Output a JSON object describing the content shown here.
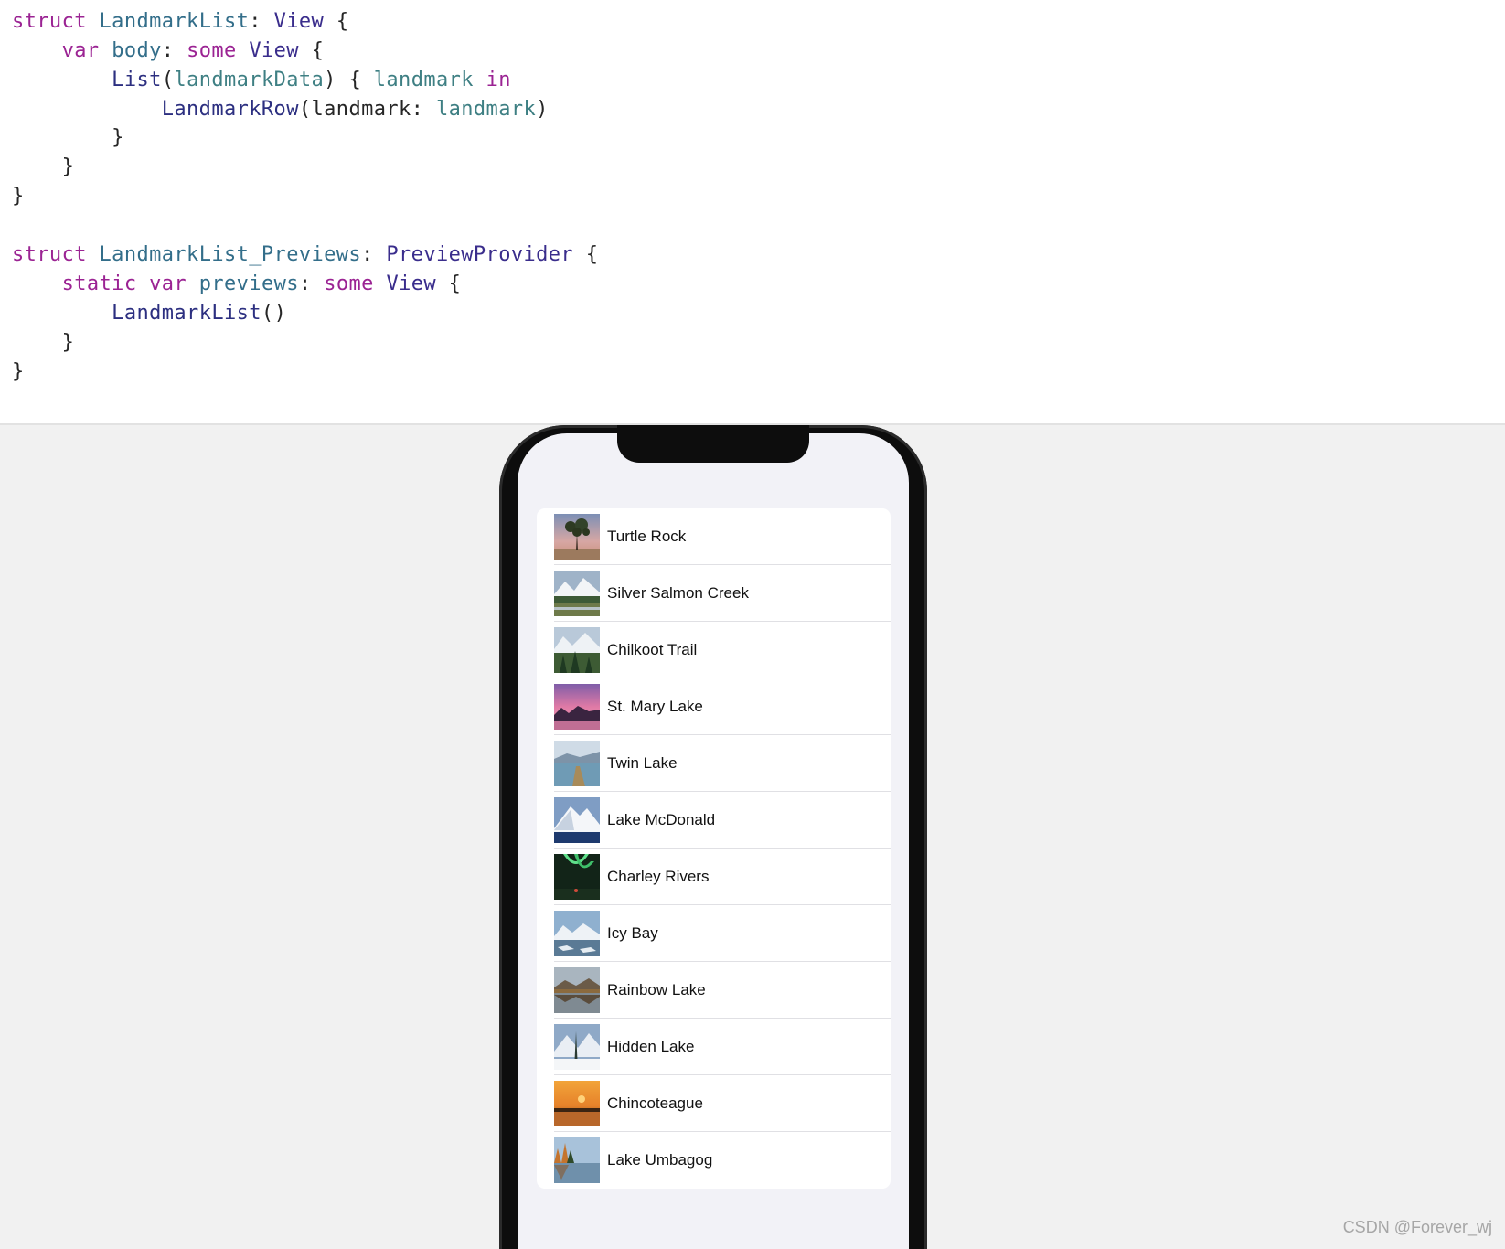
{
  "editor": {
    "lines": [
      [
        {
          "t": "struct",
          "c": "kw"
        },
        {
          "t": " ",
          "c": "pl"
        },
        {
          "t": "LandmarkList",
          "c": "dc"
        },
        {
          "t": ": ",
          "c": "pl"
        },
        {
          "t": "View",
          "c": "ty"
        },
        {
          "t": " {",
          "c": "pl"
        }
      ],
      [
        {
          "t": "    ",
          "c": "pl"
        },
        {
          "t": "var",
          "c": "kw"
        },
        {
          "t": " ",
          "c": "pl"
        },
        {
          "t": "body",
          "c": "dc"
        },
        {
          "t": ": ",
          "c": "pl"
        },
        {
          "t": "some",
          "c": "kw"
        },
        {
          "t": " ",
          "c": "pl"
        },
        {
          "t": "View",
          "c": "ty"
        },
        {
          "t": " {",
          "c": "pl"
        }
      ],
      [
        {
          "t": "        ",
          "c": "pl"
        },
        {
          "t": "List",
          "c": "fn"
        },
        {
          "t": "(",
          "c": "pl"
        },
        {
          "t": "landmarkData",
          "c": "vr"
        },
        {
          "t": ") { ",
          "c": "pl"
        },
        {
          "t": "landmark",
          "c": "vr"
        },
        {
          "t": " ",
          "c": "pl"
        },
        {
          "t": "in",
          "c": "kw"
        }
      ],
      [
        {
          "t": "            ",
          "c": "pl"
        },
        {
          "t": "LandmarkRow",
          "c": "fn"
        },
        {
          "t": "(landmark: ",
          "c": "pl"
        },
        {
          "t": "landmark",
          "c": "vr"
        },
        {
          "t": ")",
          "c": "pl"
        }
      ],
      [
        {
          "t": "        }",
          "c": "pl"
        }
      ],
      [
        {
          "t": "    }",
          "c": "pl"
        }
      ],
      [
        {
          "t": "}",
          "c": "pl"
        }
      ],
      [
        {
          "t": "",
          "c": "pl"
        }
      ],
      [
        {
          "t": "struct",
          "c": "kw"
        },
        {
          "t": " ",
          "c": "pl"
        },
        {
          "t": "LandmarkList_Previews",
          "c": "dc"
        },
        {
          "t": ": ",
          "c": "pl"
        },
        {
          "t": "PreviewProvider",
          "c": "ty"
        },
        {
          "t": " {",
          "c": "pl"
        }
      ],
      [
        {
          "t": "    ",
          "c": "pl"
        },
        {
          "t": "static",
          "c": "kw"
        },
        {
          "t": " ",
          "c": "pl"
        },
        {
          "t": "var",
          "c": "kw"
        },
        {
          "t": " ",
          "c": "pl"
        },
        {
          "t": "previews",
          "c": "dc"
        },
        {
          "t": ": ",
          "c": "pl"
        },
        {
          "t": "some",
          "c": "kw"
        },
        {
          "t": " ",
          "c": "pl"
        },
        {
          "t": "View",
          "c": "ty"
        },
        {
          "t": " {",
          "c": "pl"
        }
      ],
      [
        {
          "t": "        ",
          "c": "pl"
        },
        {
          "t": "LandmarkList",
          "c": "fn"
        },
        {
          "t": "()",
          "c": "pl"
        }
      ],
      [
        {
          "t": "    }",
          "c": "pl"
        }
      ],
      [
        {
          "t": "}",
          "c": "pl"
        }
      ]
    ]
  },
  "preview": {
    "landmarks": [
      {
        "name": "Turtle Rock",
        "thumb": "turtle-rock"
      },
      {
        "name": "Silver Salmon Creek",
        "thumb": "silver-salmon-creek"
      },
      {
        "name": "Chilkoot Trail",
        "thumb": "chilkoot-trail"
      },
      {
        "name": "St. Mary Lake",
        "thumb": "st-mary-lake"
      },
      {
        "name": "Twin Lake",
        "thumb": "twin-lake"
      },
      {
        "name": "Lake McDonald",
        "thumb": "lake-mcdonald"
      },
      {
        "name": "Charley Rivers",
        "thumb": "charley-rivers"
      },
      {
        "name": "Icy Bay",
        "thumb": "icy-bay"
      },
      {
        "name": "Rainbow Lake",
        "thumb": "rainbow-lake"
      },
      {
        "name": "Hidden Lake",
        "thumb": "hidden-lake"
      },
      {
        "name": "Chincoteague",
        "thumb": "chincoteague"
      },
      {
        "name": "Lake Umbagog",
        "thumb": "lake-umbagog"
      }
    ]
  },
  "watermark": "CSDN @Forever_wj",
  "colors": {
    "keyword": "#9b2393",
    "type": "#3a2d8c",
    "declaration": "#336e8a",
    "function": "#2c2f80",
    "variable": "#3e7f83",
    "plain": "#262626",
    "canvas": "#f1f1f1",
    "screen": "#f2f2f7"
  }
}
